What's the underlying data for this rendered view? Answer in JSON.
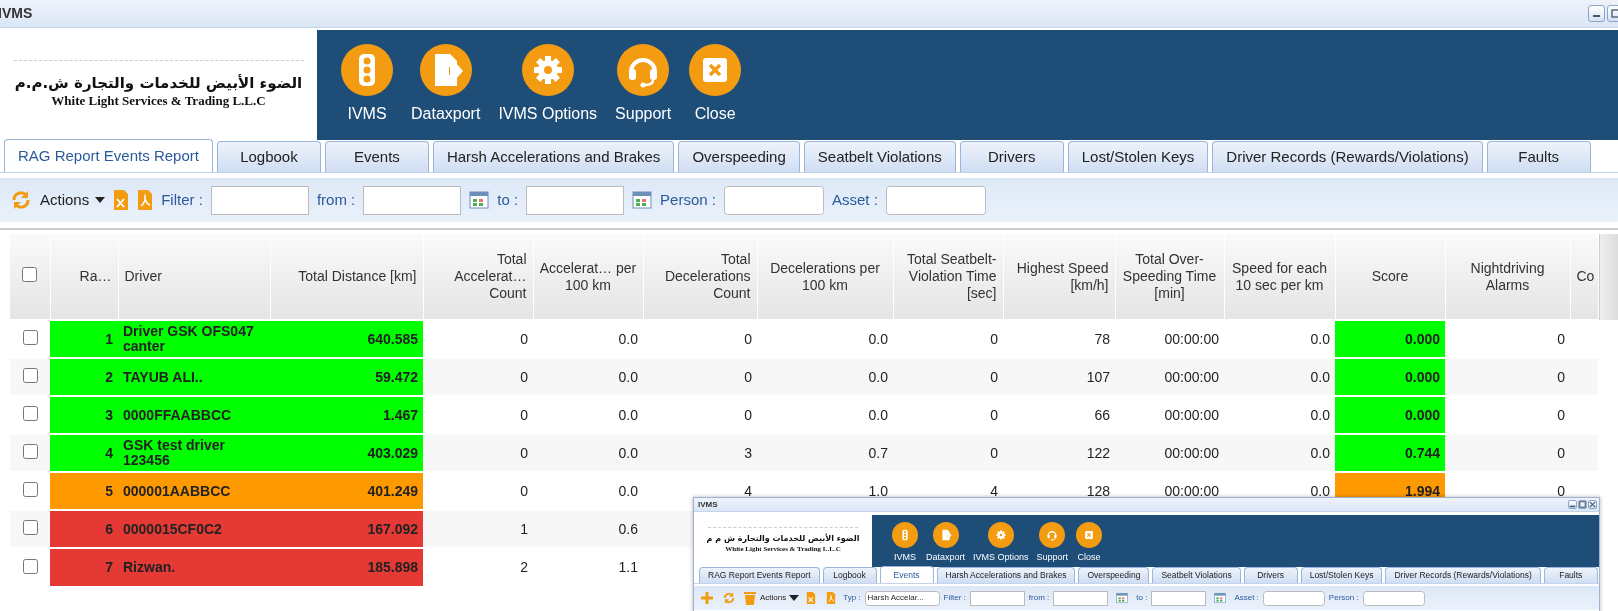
{
  "window": {
    "title": "IVMS"
  },
  "company": {
    "name_ar": "الضوء الأبيض للخدمات والتجارة ش.م.م",
    "name_en": "White Light Services & Trading L.L.C"
  },
  "nav_buttons": [
    {
      "label": "IVMS"
    },
    {
      "label": "Dataxport"
    },
    {
      "label": "IVMS Options"
    },
    {
      "label": "Support"
    },
    {
      "label": "Close"
    }
  ],
  "tabs": [
    {
      "label": "RAG Report Events Report",
      "selected": true
    },
    {
      "label": "Logbook",
      "selected": false
    },
    {
      "label": "Events",
      "selected": false
    },
    {
      "label": "Harsh Accelerations and Brakes",
      "selected": false
    },
    {
      "label": "Overspeeding",
      "selected": false
    },
    {
      "label": "Seatbelt Violations",
      "selected": false
    },
    {
      "label": "Drivers",
      "selected": false
    },
    {
      "label": "Lost/Stolen Keys",
      "selected": false
    },
    {
      "label": "Driver Records (Rewards/Violations)",
      "selected": false
    },
    {
      "label": "Faults",
      "selected": false
    }
  ],
  "toolbar": {
    "actions": "Actions",
    "filter_label": "Filter :",
    "from_label": "from :",
    "to_label": "to :",
    "person_label": "Person :",
    "asset_label": "Asset :"
  },
  "table": {
    "select_all_checked": false,
    "columns": [
      {
        "label": "Ra…",
        "kind": "rag"
      },
      {
        "label": "Driver",
        "kind": "rag"
      },
      {
        "label": "Total Distance [km]",
        "kind": "rag"
      },
      {
        "label": "Total Accelerat… Count",
        "kind": "plain"
      },
      {
        "label": "Accelerat… per 100 km",
        "kind": "plain"
      },
      {
        "label": "Total Decelerations Count",
        "kind": "plain"
      },
      {
        "label": "Decelerations per 100 km",
        "kind": "plain"
      },
      {
        "label": "Total Seatbelt-Violation Time [sec]",
        "kind": "plain"
      },
      {
        "label": "Highest Speed [km/h]",
        "kind": "plain"
      },
      {
        "label": "Total Over-Speeding Time [min]",
        "kind": "plain"
      },
      {
        "label": "Speed for each 10 sec per km",
        "kind": "plain"
      },
      {
        "label": "Score",
        "kind": "score"
      },
      {
        "label": "Nightdriving Alarms",
        "kind": "plain"
      },
      {
        "label": "Co",
        "kind": "plain"
      }
    ],
    "rows": [
      {
        "checked": false,
        "color": "#00ff00",
        "cells": [
          "1",
          "Driver GSK OFS047 canter",
          "640.585",
          "0",
          "0.0",
          "0",
          "0.0",
          "0",
          "78",
          "00:00:00",
          "0.0",
          {
            "text": "0.000",
            "color": "#00ff00"
          },
          "0"
        ]
      },
      {
        "checked": false,
        "color": "#00ff00",
        "cells": [
          "2",
          "TAYUB ALI..",
          "59.472",
          "0",
          "0.0",
          "0",
          "0.0",
          "0",
          "107",
          "00:00:00",
          "0.0",
          {
            "text": "0.000",
            "color": "#00ff00"
          },
          "0"
        ]
      },
      {
        "checked": false,
        "color": "#00ff00",
        "cells": [
          "3",
          "0000FFAABBCC",
          "1.467",
          "0",
          "0.0",
          "0",
          "0.0",
          "0",
          "66",
          "00:00:00",
          "0.0",
          {
            "text": "0.000",
            "color": "#00ff00"
          },
          "0"
        ]
      },
      {
        "checked": false,
        "color": "#00ff00",
        "cells": [
          "4",
          "GSK test driver 123456",
          "403.029",
          "0",
          "0.0",
          "3",
          "0.7",
          "0",
          "122",
          "00:00:00",
          "0.0",
          {
            "text": "0.744",
            "color": "#00ff00"
          },
          "0"
        ]
      },
      {
        "checked": false,
        "color": "#ff9900",
        "cells": [
          "5",
          "000001AABBCC",
          "401.249",
          "0",
          "0.0",
          "4",
          "1.0",
          "4",
          "128",
          "00:00:00",
          "0.0",
          {
            "text": "1.994",
            "color": "#ff9900"
          },
          "0"
        ]
      },
      {
        "checked": false,
        "color": "#e53935",
        "cells": [
          "6",
          "0000015CF0C2",
          "167.092",
          "1",
          "0.6"
        ]
      },
      {
        "checked": false,
        "color": "#e53935",
        "cells": [
          "7",
          "Rizwan.",
          "185.898",
          "2",
          "1.1"
        ]
      }
    ]
  },
  "inset_window": {
    "title": "IVMS",
    "company": {
      "name_ar": "الضوء الأبيض للخدمات والتجارة ش م م",
      "name_en": "White Light Services & Trading L.L.C"
    },
    "nav_buttons": [
      {
        "label": "IVMS"
      },
      {
        "label": "Dataxport"
      },
      {
        "label": "IVMS Options"
      },
      {
        "label": "Support"
      },
      {
        "label": "Close"
      }
    ],
    "tabs": [
      {
        "label": "RAG Report Events Report",
        "selected": false
      },
      {
        "label": "Logbook",
        "selected": false
      },
      {
        "label": "Events",
        "selected": true
      },
      {
        "label": "Harsh Accelerations and Brakes",
        "selected": false
      },
      {
        "label": "Overspeeding",
        "selected": false
      },
      {
        "label": "Seatbelt Violations",
        "selected": false
      },
      {
        "label": "Drivers",
        "selected": false
      },
      {
        "label": "Lost/Stolen Keys",
        "selected": false
      },
      {
        "label": "Driver Records (Rewards/Violations)",
        "selected": false
      },
      {
        "label": "Faults",
        "selected": false
      }
    ],
    "toolbar": {
      "actions": "Actions",
      "type_label": "Typ :",
      "type_value": "Harsh Accelar...",
      "filter_label": "Filter :",
      "from_label": "from :",
      "to_label": "to :",
      "asset_label": "Asset :",
      "person_label": "Person :"
    }
  }
}
